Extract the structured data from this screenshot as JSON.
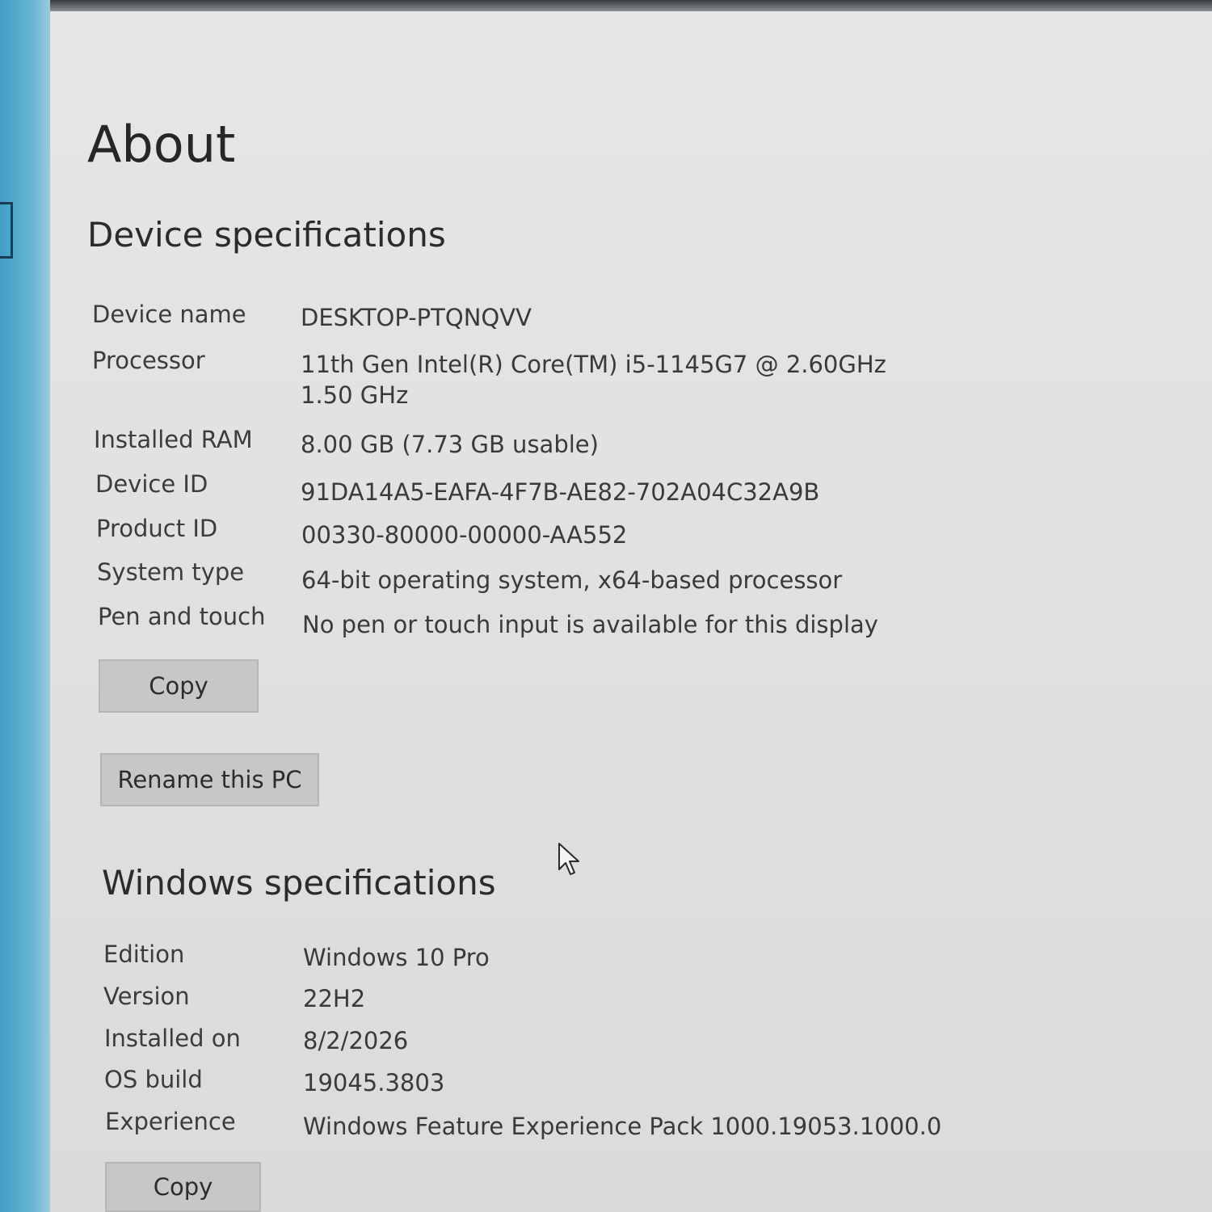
{
  "page": {
    "title": "About"
  },
  "device_specs": {
    "heading": "Device specifications",
    "rows": [
      {
        "label": "Device name",
        "value": "DESKTOP-PTQNQVV"
      },
      {
        "label": "Processor",
        "value": "11th Gen Intel(R) Core(TM) i5-1145G7 @ 2.60GHz   1.50 GHz"
      },
      {
        "label": "Installed RAM",
        "value": "8.00 GB (7.73 GB usable)"
      },
      {
        "label": "Device ID",
        "value": "91DA14A5-EAFA-4F7B-AE82-702A04C32A9B"
      },
      {
        "label": "Product ID",
        "value": "00330-80000-00000-AA552"
      },
      {
        "label": "System type",
        "value": "64-bit operating system, x64-based processor"
      },
      {
        "label": "Pen and touch",
        "value": "No pen or touch input is available for this display"
      }
    ],
    "copy_label": "Copy",
    "rename_label": "Rename this PC"
  },
  "windows_specs": {
    "heading": "Windows specifications",
    "rows": [
      {
        "label": "Edition",
        "value": "Windows 10 Pro"
      },
      {
        "label": "Version",
        "value": "22H2"
      },
      {
        "label": "Installed on",
        "value": "8/2/2026"
      },
      {
        "label": "OS build",
        "value": "19045.3803"
      },
      {
        "label": "Experience",
        "value": "Windows Feature Experience Pack 1000.19053.1000.0"
      }
    ],
    "copy_label": "Copy"
  },
  "colors": {
    "accent_strip": "#3f9ec6",
    "background": "#dcdedf",
    "button": "#c6c7c8"
  }
}
